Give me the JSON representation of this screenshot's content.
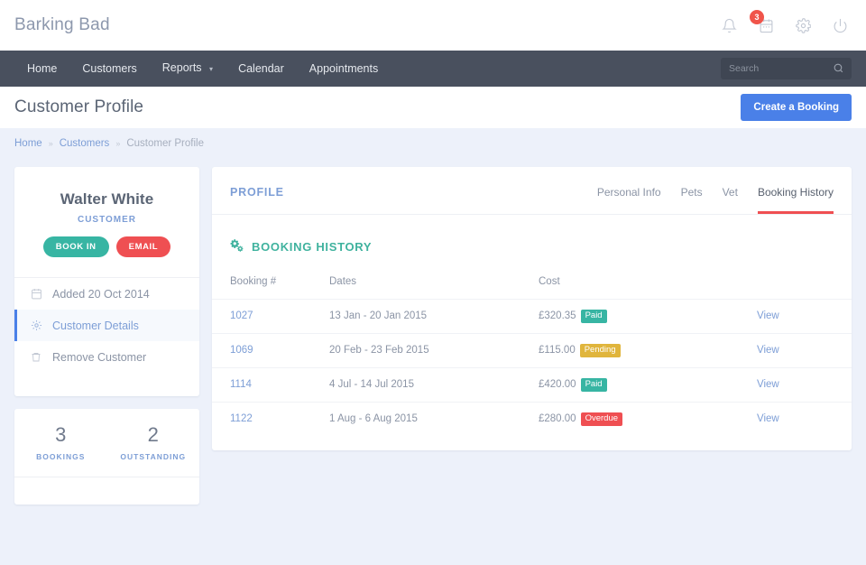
{
  "topbar": {
    "brand": "Barking Bad",
    "icons": [
      {
        "name": "bell-icon",
        "label": "Notifications"
      },
      {
        "name": "calendar-icon",
        "label": "Calendar",
        "badge": "3"
      },
      {
        "name": "gear-icon",
        "label": "Settings"
      },
      {
        "name": "power-icon",
        "label": "Log out"
      }
    ]
  },
  "nav": {
    "items": [
      {
        "label": "Home",
        "caret": false
      },
      {
        "label": "Customers",
        "caret": false
      },
      {
        "label": "Reports",
        "caret": true
      },
      {
        "label": "Calendar",
        "caret": false
      },
      {
        "label": "Appointments",
        "caret": false
      }
    ],
    "search": {
      "value": "",
      "placeholder": "Search"
    }
  },
  "page": {
    "title": "Customer Profile",
    "action_button": "Create a Booking",
    "breadcrumb": [
      {
        "label": "Home",
        "link": true
      },
      {
        "label": "Customers",
        "link": true
      },
      {
        "label": "Customer Profile",
        "link": false
      }
    ],
    "breadcrumb_separator": "»"
  },
  "profile_card": {
    "name": "Walter White",
    "role": "CUSTOMER",
    "buttons": [
      {
        "label": "BOOK IN",
        "color": "#37b5a3"
      },
      {
        "label": "EMAIL",
        "color": "#ef4f52"
      }
    ],
    "rows": [
      {
        "icon": "calendar-icon",
        "label": "Added 20 Oct 2014",
        "active": false,
        "interactable": false
      },
      {
        "icon": "gear-icon",
        "label": "Customer Details",
        "active": true,
        "interactable": true
      },
      {
        "icon": "trash-icon",
        "label": "Remove Customer",
        "active": false,
        "interactable": true
      }
    ]
  },
  "stats_card": {
    "stats": [
      {
        "value": "3",
        "label": "BOOKINGS"
      },
      {
        "value": "2",
        "label": "OUTSTANDING"
      }
    ]
  },
  "panel": {
    "title": "PROFILE",
    "tabs": [
      {
        "label": "Personal Info",
        "active": false
      },
      {
        "label": "Pets",
        "active": false
      },
      {
        "label": "Vet",
        "active": false
      },
      {
        "label": "Booking History",
        "active": true
      }
    ],
    "section_title": "BOOKING HISTORY",
    "section_icon": "cogs-icon",
    "table": {
      "columns": [
        "Booking #",
        "Dates",
        "Cost",
        ""
      ],
      "rows": [
        {
          "id": "1027",
          "dates": "13 Jan - 20 Jan 2015",
          "cost": "£320.35",
          "status": "Paid",
          "status_color": "#37b5a3",
          "action": "View"
        },
        {
          "id": "1069",
          "dates": "20 Feb - 23 Feb 2015",
          "cost": "£115.00",
          "status": "Pending",
          "status_color": "#e0b53c",
          "action": "View"
        },
        {
          "id": "1114",
          "dates": "4 Jul - 14 Jul 2015",
          "cost": "£420.00",
          "status": "Paid",
          "status_color": "#37b5a3",
          "action": "View"
        },
        {
          "id": "1122",
          "dates": "1 Aug - 6 Aug 2015",
          "cost": "£280.00",
          "status": "Overdue",
          "status_color": "#ef4f52",
          "action": "View"
        }
      ]
    }
  },
  "theme": {
    "accent_blue": "#4a80e8",
    "link_blue": "#7d9ed6",
    "teal": "#37b5a3",
    "red": "#ef4f52",
    "yellow": "#e0b53c",
    "nav_dark": "#49505e",
    "page_bg": "#edf1fa"
  }
}
